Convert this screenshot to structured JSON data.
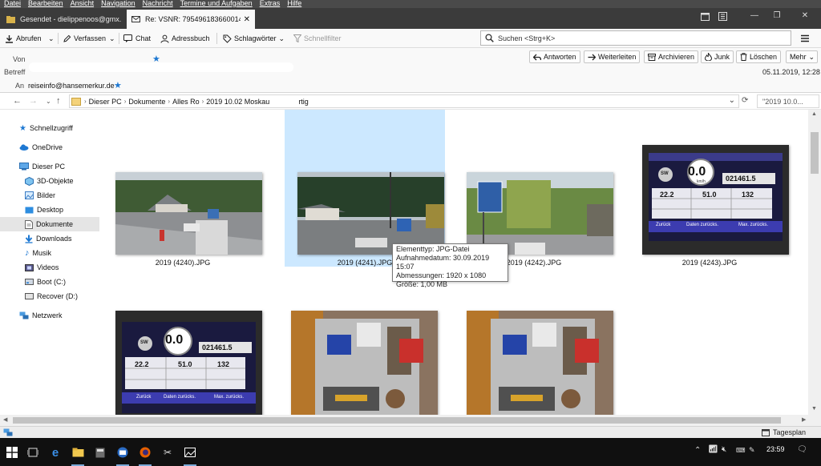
{
  "menubar": [
    "Datei",
    "Bearbeiten",
    "Ansicht",
    "Navigation",
    "Nachricht",
    "Termine und Aufgaben",
    "Extras",
    "Hilfe"
  ],
  "tabs": [
    {
      "label": "Gesendet - dielippenoos@gmx."
    },
    {
      "label": "Re: VSNR: 7954961836600146"
    }
  ],
  "toolbar": {
    "abrufen": "Abrufen",
    "verfassen": "Verfassen",
    "chat": "Chat",
    "adressbuch": "Adressbuch",
    "schlagwoerter": "Schlagwörter",
    "schnellfilter": "Schnellfilter",
    "search_placeholder": "Suchen <Strg+K>"
  },
  "header": {
    "von_label": "Von",
    "betreff_label": "Betreff",
    "an_label": "An",
    "an_value": "reiseinfo@hansemerkur.de",
    "date": "05.11.2019, 12:28",
    "buttons": {
      "antworten": "Antworten",
      "weiterleiten": "Weiterleiten",
      "archivieren": "Archivieren",
      "junk": "Junk",
      "loeschen": "Löschen",
      "mehr": "Mehr"
    }
  },
  "explorer": {
    "path": [
      "Dieser PC",
      "Dokumente",
      "Alles Ro",
      "2019 10.02 Moskau"
    ],
    "path_tail": "rtig",
    "search_text": "\"2019 10.0...",
    "nav": [
      "Schnellzugriff",
      "OneDrive",
      "Dieser PC",
      "3D-Objekte",
      "Bilder",
      "Desktop",
      "Dokumente",
      "Downloads",
      "Musik",
      "Videos",
      "Boot (C:)",
      "Recover (D:)",
      "Netzwerk"
    ],
    "files": [
      "2019 (4240).JPG",
      "2019 (4241).JPG",
      "2019 (4242).JPG",
      "2019 (4243).JPG"
    ],
    "tooltip": {
      "type": "Elementtyp: JPG-Datei",
      "date": "Aufnahmedatum: 30.09.2019 15:07",
      "dims": "Abmessungen: 1920 x 1080",
      "size": "Größe: 1,00 MB"
    },
    "gauge": {
      "speed": "0.0",
      "unit": "km/h",
      "heading": "SW",
      "odometer": "021461.5",
      "v1": "22.2",
      "v2": "51.0",
      "v3": "132",
      "btn1": "Zurück",
      "btn2": "Daten zurücks.",
      "btn3": "Max. zurücks."
    }
  },
  "status": {
    "tagesplan": "Tagesplan"
  },
  "taskbar": {
    "time": "23:59"
  }
}
